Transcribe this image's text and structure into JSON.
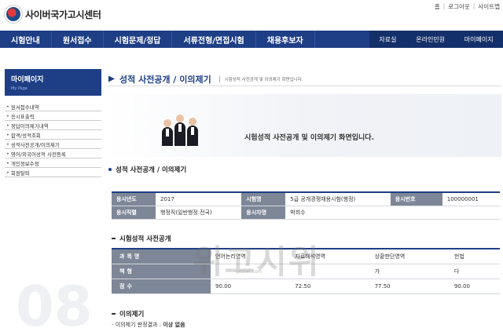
{
  "header": {
    "logo_text": "사이버국가고시센터",
    "util_links": [
      "홈",
      "로그아웃",
      "사이트맵"
    ]
  },
  "nav": {
    "main": [
      "시험안내",
      "원서접수",
      "시험문제/정답",
      "서류전형/면접시험",
      "채용후보자"
    ],
    "sub": [
      "자료실",
      "온라인민원",
      "마이페이지"
    ]
  },
  "sidebar": {
    "title": "마이페이지",
    "subtitle": "My Page",
    "items": [
      "원서접수내역",
      "응시표출력",
      "정답이의제기내역",
      "합격/성적조회",
      "성적사전공개/이의제기",
      "영어/외국어성적 사전등록",
      "개인정보수정",
      "회원탈퇴"
    ],
    "decor_number": "08"
  },
  "main": {
    "title": "성적 사전공개 / 이의제기",
    "description": "시험성적 사전공개 및 이의제기 화면입니다.",
    "banner_text": "시험성적 사전공개 및 이의제기 화면입니다.",
    "section_title": "성적 사전공개 / 이의제기",
    "info": {
      "year_label": "응시년도",
      "year": "2017",
      "exam_label": "시험명",
      "exam": "5급 공개경쟁채용시험(행정)",
      "number_label": "응시번호",
      "number": "100000001",
      "field_label": "응시직렬",
      "field": "행정직(일반행정:전국)",
      "name_label": "응시자명",
      "name": "박희수"
    },
    "score_section_title": "시험성적 사전공개",
    "score": {
      "row_labels": [
        "과목명",
        "책형",
        "점수"
      ],
      "subjects": [
        "언어논리영역",
        "자료해석영역",
        "상황판단영역",
        "헌법"
      ],
      "booklet": [
        "",
        "",
        "가",
        "다"
      ],
      "points": [
        "90.00",
        "72.50",
        "77.50",
        "90.00"
      ]
    },
    "objection_title": "이의제기",
    "objection_label": "- 이의제기 판정결과 : ",
    "objection_value": "이상 없음"
  },
  "overlay": {
    "watermark": "위고시위",
    "watermark_sub": "gosiwi.com"
  }
}
